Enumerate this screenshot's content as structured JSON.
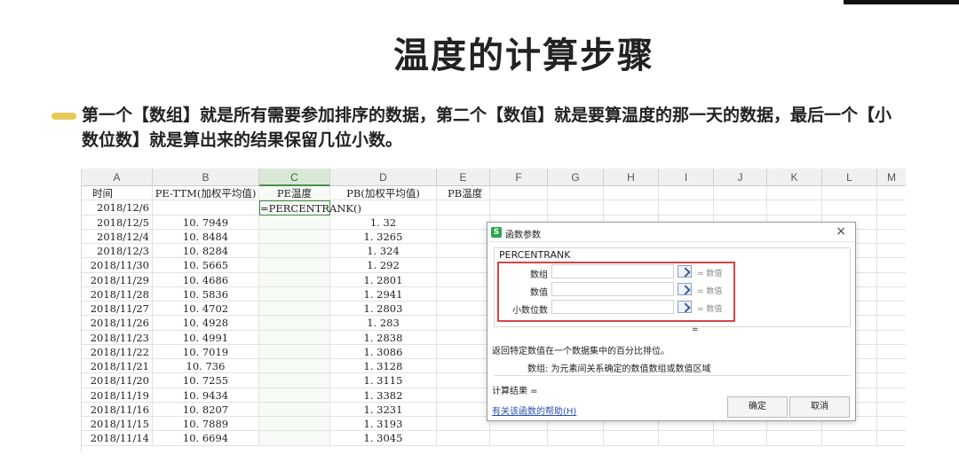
{
  "slide": {
    "title": "温度的计算步骤",
    "bullet": "第一个【数组】就是所有需要参加排序的数据，第二个【数值】就是要算温度的那一天的数据，最后一个【小数位数】就是算出来的结果保留几位小数。"
  },
  "sheet": {
    "columns": [
      "A",
      "B",
      "C",
      "D",
      "E",
      "F",
      "G",
      "H",
      "I",
      "J",
      "K",
      "L",
      "M"
    ],
    "active_column": "C",
    "header_row": [
      "时间",
      "PE-TTM(加权平均值)",
      "PE温度",
      "PB(加权平均值)",
      "PB温度"
    ],
    "active_cell_formula": "=PERCENTRANK()",
    "rows": [
      {
        "date": "2018/12/6",
        "pe": "",
        "pb": ""
      },
      {
        "date": "2018/12/5",
        "pe": "10. 7949",
        "pb": "1. 32"
      },
      {
        "date": "2018/12/4",
        "pe": "10. 8484",
        "pb": "1. 3265"
      },
      {
        "date": "2018/12/3",
        "pe": "10. 8284",
        "pb": "1. 324"
      },
      {
        "date": "2018/11/30",
        "pe": "10. 5665",
        "pb": "1. 292"
      },
      {
        "date": "2018/11/29",
        "pe": "10. 4686",
        "pb": "1. 2801"
      },
      {
        "date": "2018/11/28",
        "pe": "10. 5836",
        "pb": "1. 2941"
      },
      {
        "date": "2018/11/27",
        "pe": "10. 4702",
        "pb": "1. 2803"
      },
      {
        "date": "2018/11/26",
        "pe": "10. 4928",
        "pb": "1. 283"
      },
      {
        "date": "2018/11/23",
        "pe": "10. 4991",
        "pb": "1. 2838"
      },
      {
        "date": "2018/11/22",
        "pe": "10. 7019",
        "pb": "1. 3086"
      },
      {
        "date": "2018/11/21",
        "pe": "10. 736",
        "pb": "1. 3128"
      },
      {
        "date": "2018/11/20",
        "pe": "10. 7255",
        "pb": "1. 3115"
      },
      {
        "date": "2018/11/19",
        "pe": "10. 9434",
        "pb": "1. 3382"
      },
      {
        "date": "2018/11/16",
        "pe": "10. 8207",
        "pb": "1. 3231"
      },
      {
        "date": "2018/11/15",
        "pe": "10. 7889",
        "pb": "1. 3193"
      },
      {
        "date": "2018/11/14",
        "pe": "10. 6694",
        "pb": "1. 3045"
      }
    ]
  },
  "dialog": {
    "title": "函数参数",
    "app_icon": "S",
    "close": "×",
    "function_name": "PERCENTRANK",
    "args": [
      {
        "label": "数组",
        "result": "= 数值"
      },
      {
        "label": "数值",
        "result": "= 数值"
      },
      {
        "label": "小数位数",
        "result": "= 数值"
      }
    ],
    "function_result_eq": "=",
    "description": "返回特定数值在一个数据集中的百分比排位。",
    "arg_help": "数组:  为元素间关系确定的数值数组或数值区域",
    "calc_result": "计算结果 =",
    "help_link": "有关该函数的帮助(H)",
    "ok_label": "确定",
    "cancel_label": "取消"
  },
  "colors": {
    "accent": "#e7c95a",
    "active_green": "#3c8c3c",
    "highlight_red": "#d64545",
    "link_blue": "#2a4fb0"
  }
}
